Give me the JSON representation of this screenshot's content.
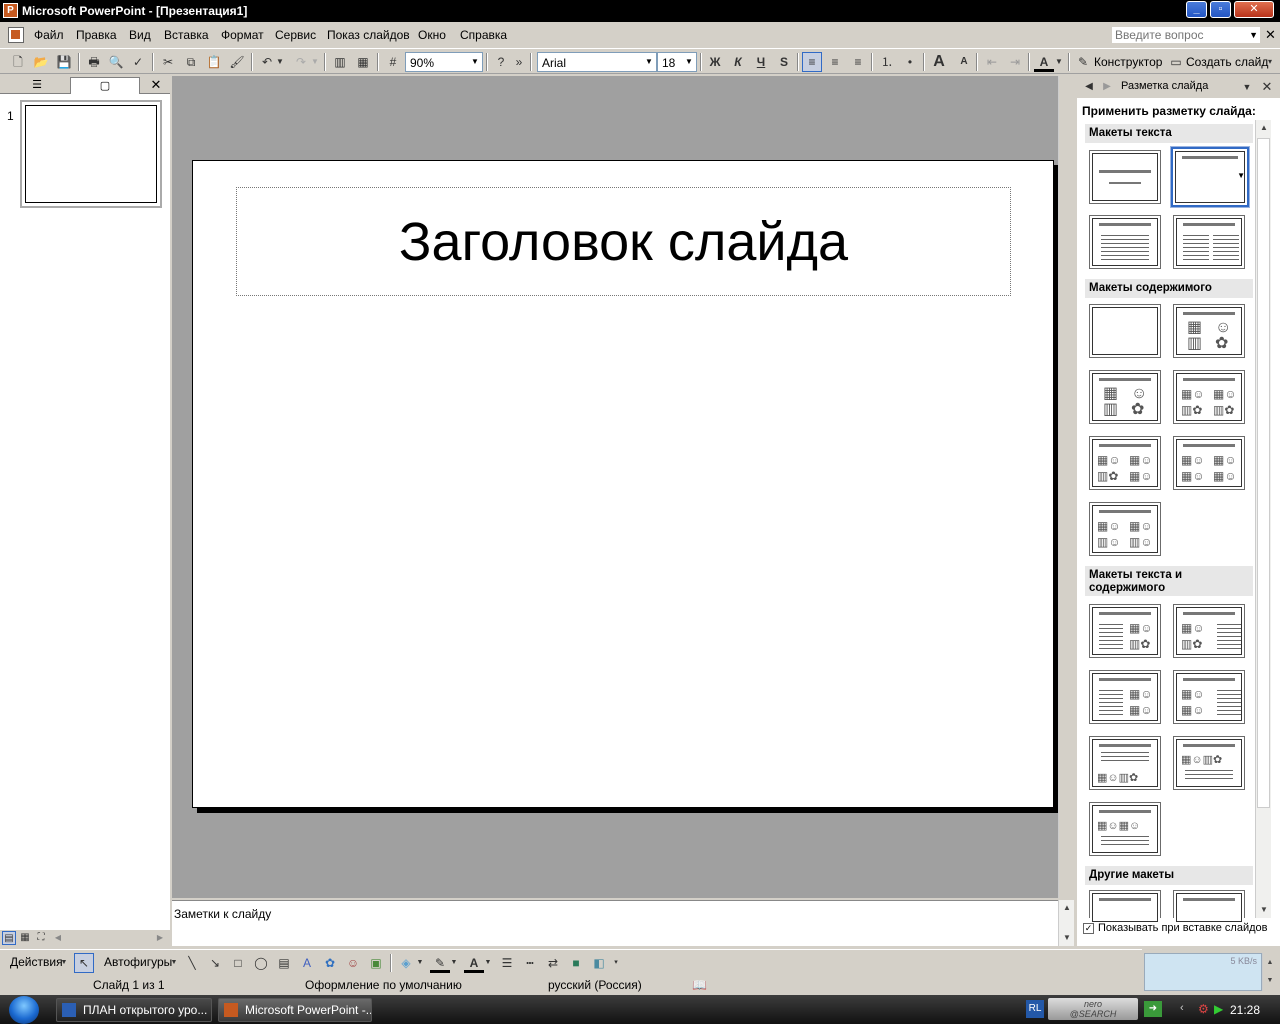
{
  "window": {
    "title": "Microsoft PowerPoint - [Презентация1]"
  },
  "menu": {
    "items": [
      "Файл",
      "Правка",
      "Вид",
      "Вставка",
      "Формат",
      "Сервис",
      "Показ слайдов",
      "Окно",
      "Справка"
    ],
    "ask_placeholder": "Введите вопрос"
  },
  "toolbar": {
    "zoom": "90%",
    "font": "Arial",
    "font_size": "18",
    "bold": "Ж",
    "italic": "К",
    "underline": "Ч",
    "shadow": "S",
    "designer_label": "Конструктор",
    "new_slide_label": "Создать слайд"
  },
  "left_pane": {
    "thumb_number": "1"
  },
  "slide": {
    "title_placeholder": "Заголовок слайда"
  },
  "notes": {
    "placeholder": "Заметки к слайду"
  },
  "task_pane": {
    "title": "Разметка слайда",
    "apply_label": "Применить разметку слайда:",
    "sections": [
      "Макеты текста",
      "Макеты содержимого",
      "Макеты текста и содержимого",
      "Другие макеты"
    ],
    "show_on_insert": "Показывать при вставке слайдов"
  },
  "draw_toolbar": {
    "actions": "Действия",
    "autoshapes": "Автофигуры"
  },
  "status": {
    "slide": "Слайд 1 из 1",
    "design": "Оформление по умолчанию",
    "language": "русский (Россия)"
  },
  "network": {
    "speed": "5 KB/s"
  },
  "taskbar": {
    "buttons": [
      "ПЛАН открытого уро...",
      "Microsoft PowerPoint -..."
    ],
    "lang": "RL",
    "nero": "nero\n@SEARCH",
    "clock": "21:28"
  }
}
